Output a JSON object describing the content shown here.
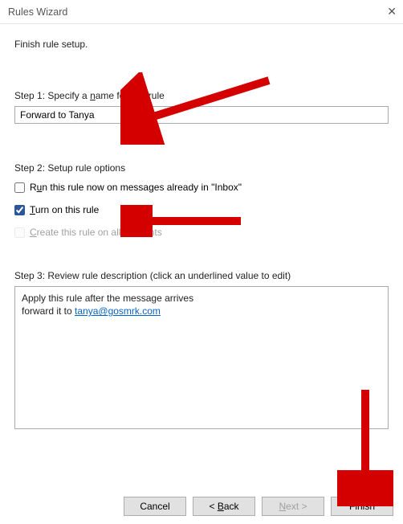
{
  "window": {
    "title": "Rules Wizard",
    "close_label": "✕"
  },
  "heading": "Finish rule setup.",
  "step1": {
    "label_pre": "Step 1: Specify a ",
    "label_key": "n",
    "label_post": "ame for this rule",
    "value": "Forward to Tanya"
  },
  "step2": {
    "heading": "Step 2: Setup rule options",
    "opt_run_pre": "R",
    "opt_run_key": "u",
    "opt_run_post": "n this rule now on messages already in \"Inbox\"",
    "opt_run_checked": false,
    "opt_turn_on_key": "T",
    "opt_turn_on_post": "urn on this rule",
    "opt_turn_on_checked": true,
    "opt_create_all_key": "C",
    "opt_create_all_post": "reate this rule on all accounts",
    "opt_create_all_checked": false
  },
  "step3": {
    "heading": "Step 3: Review rule description (click an underlined value to edit)",
    "line1": "Apply this rule after the message arrives",
    "line2_pre": "forward it to ",
    "line2_link": "tanya@gosmrk.com"
  },
  "buttons": {
    "cancel": "Cancel",
    "back_pre": "< ",
    "back_key": "B",
    "back_post": "ack",
    "next_key": "N",
    "next_post": "ext >",
    "finish": "Finish"
  }
}
